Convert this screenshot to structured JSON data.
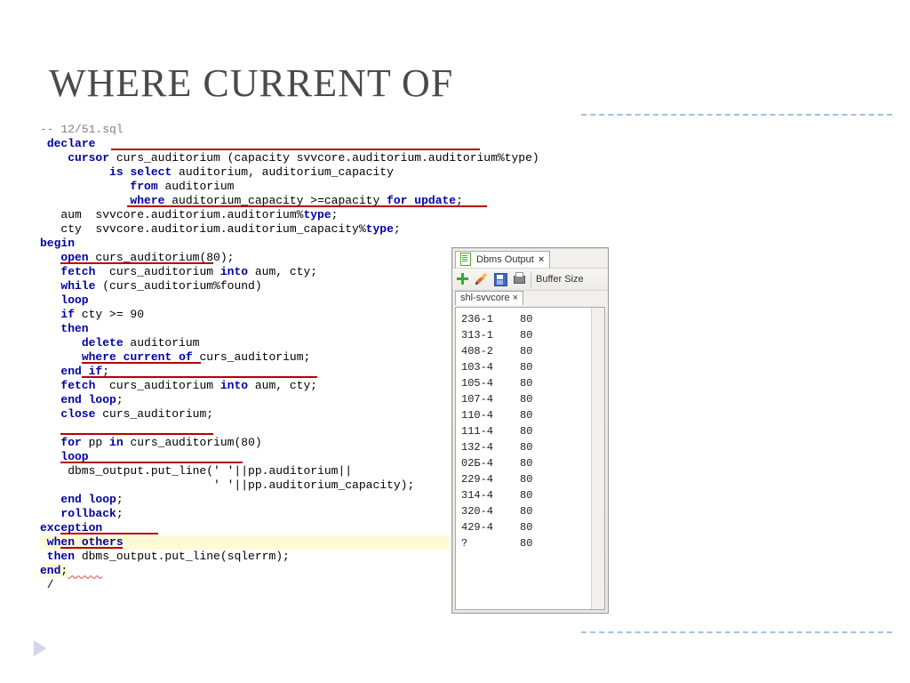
{
  "title": "WHERE CURRENT OF",
  "code": {
    "c01": "-- 12/51.sql",
    "c02a": "declare",
    "c03a": "cursor",
    "c03b": " curs_auditorium (capacity svvcore.auditorium.auditorium%type)",
    "c04a": "is",
    "c04b": "select",
    "c04c": " auditorium, auditorium_capacity",
    "c05a": "from",
    "c05b": " auditorium",
    "c06a": "where",
    "c06b": " auditorium_capacity >=capacity ",
    "c06c": "for",
    "c06d": "update",
    "c06e": ";",
    "c07a": "   aum  svvcore.auditorium.auditorium%",
    "c07b": "type",
    "c07c": ";",
    "c08a": "   cty  svvcore.auditorium.auditorium_capacity%",
    "c08b": "type",
    "c08c": ";",
    "c09": "begin",
    "c10a": "open",
    "c10b": " curs_auditorium(80);",
    "c11a": "fetch",
    "c11b": "  curs_auditorium ",
    "c11c": "into",
    "c11d": " aum, cty;",
    "c12a": "while",
    "c12b": " (curs_auditorium%found)",
    "c13": "loop",
    "c14a": "if",
    "c14b": " cty >= 90",
    "c15": "then",
    "c16a": "delete",
    "c16b": " auditorium",
    "c17a": "where",
    "c17b": "current",
    "c17c": "of",
    "c17d": " curs_auditorium;",
    "c18a": "end",
    "c18b": "if",
    "c18c": ";",
    "c19a": "fetch",
    "c19b": "  curs_auditorium ",
    "c19c": "into",
    "c19d": " aum, cty;",
    "c20a": "end",
    "c20b": "loop",
    "c20c": ";",
    "c21a": "close",
    "c21b": " curs_auditorium;",
    "c22": "",
    "c23a": "for",
    "c23b": " pp ",
    "c23c": "in",
    "c23d": " curs_auditorium(80)",
    "c24": "loop",
    "c25": "    dbms_output.put_line(' '||pp.auditorium||",
    "c26": "                         ' '||pp.auditorium_capacity);",
    "c27a": "end",
    "c27b": "loop",
    "c27c": ";",
    "c28": "rollback",
    "c29": "exception",
    "c30a": " when",
    "c30b": "others",
    "c31a": " then",
    "c31b": " dbms_output.put_line(sqlerrm);",
    "c32": "end",
    "c33": " /"
  },
  "panel": {
    "tab_label": "Dbms Output",
    "buffer_label": "Buffer Size",
    "connection": "shl-svvcore",
    "rows": [
      {
        "k": "236-1",
        "v": "80"
      },
      {
        "k": "313-1",
        "v": "80"
      },
      {
        "k": "408-2",
        "v": "80"
      },
      {
        "k": "103-4",
        "v": "80"
      },
      {
        "k": "105-4",
        "v": "80"
      },
      {
        "k": "107-4",
        "v": "80"
      },
      {
        "k": "110-4",
        "v": "80"
      },
      {
        "k": "111-4",
        "v": "80"
      },
      {
        "k": "132-4",
        "v": "80"
      },
      {
        "k": "02Б-4",
        "v": "80"
      },
      {
        "k": "229-4",
        "v": "80"
      },
      {
        "k": "314-4",
        "v": "80"
      },
      {
        "k": "320-4",
        "v": "80"
      },
      {
        "k": "429-4",
        "v": "80"
      },
      {
        "k": "?",
        "v": "80"
      }
    ]
  }
}
